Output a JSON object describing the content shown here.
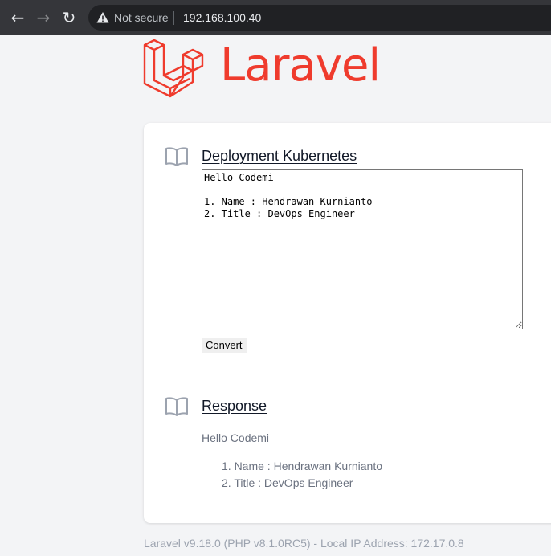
{
  "browser": {
    "nav_icons": [
      "back-arrow-icon",
      "forward-arrow-icon",
      "reload-icon"
    ],
    "security_label": "Not secure",
    "url": "192.168.100.40"
  },
  "brand": {
    "name": "Laravel",
    "color": "#ef3b2d"
  },
  "form": {
    "title": "Deployment Kubernetes",
    "textarea_value": "Hello Codemi\n\n1. Name : Hendrawan Kurnianto\n2. Title : DevOps Engineer",
    "button_label": "Convert"
  },
  "response": {
    "title": "Response",
    "greeting": "Hello Codemi",
    "items": [
      "1. Name : Hendrawan Kurnianto",
      "2. Title : DevOps Engineer"
    ]
  },
  "footer": {
    "text": "Laravel v9.18.0 (PHP v8.1.0RC5) - Local IP Address: 172.17.0.8"
  }
}
